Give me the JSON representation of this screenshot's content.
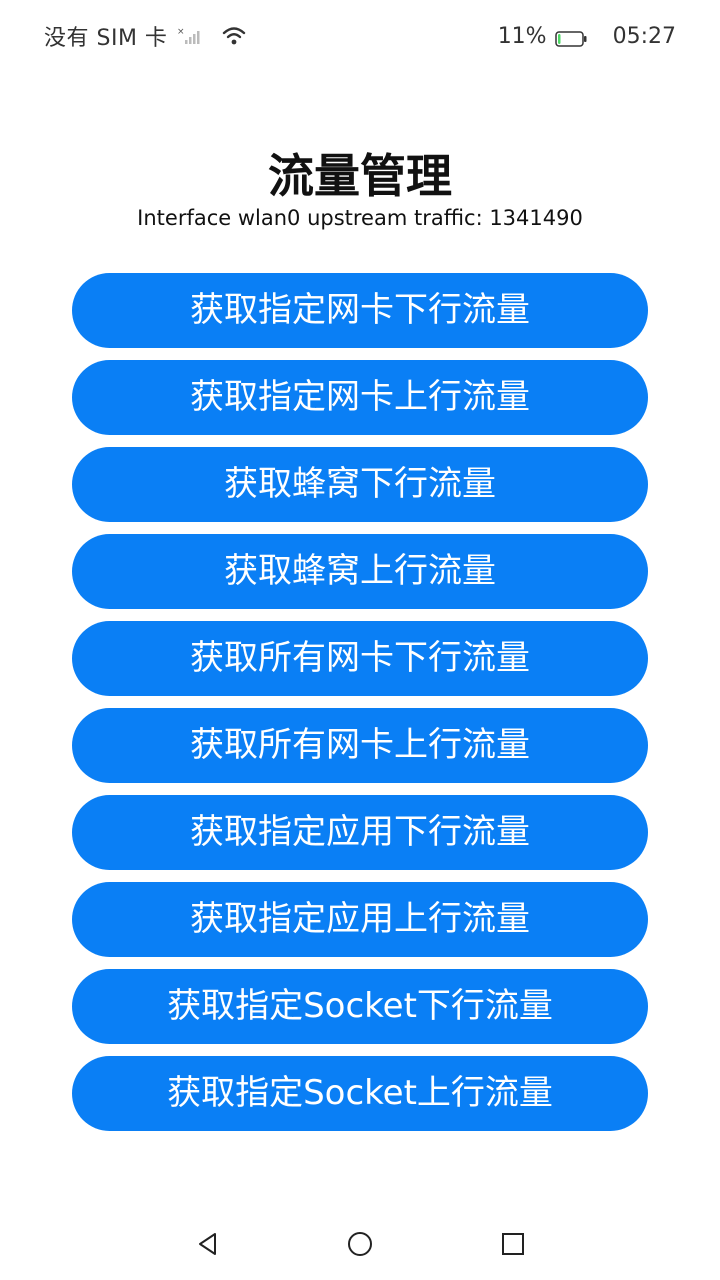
{
  "status_bar": {
    "sim_status": "没有 SIM 卡",
    "battery_percent": "11%",
    "time": "05:27",
    "battery_level": 0.11,
    "icons": [
      "signal-icon",
      "wifi-icon",
      "battery-icon"
    ]
  },
  "header": {
    "title": "流量管理",
    "traffic_info": "Interface wlan0 upstream traffic: 1341490"
  },
  "buttons": [
    {
      "label": "获取指定网卡下行流量"
    },
    {
      "label": "获取指定网卡上行流量"
    },
    {
      "label": "获取蜂窝下行流量"
    },
    {
      "label": "获取蜂窝上行流量"
    },
    {
      "label": "获取所有网卡下行流量"
    },
    {
      "label": "获取所有网卡上行流量"
    },
    {
      "label": "获取指定应用下行流量"
    },
    {
      "label": "获取指定应用上行流量"
    },
    {
      "label": "获取指定Socket下行流量"
    },
    {
      "label": "获取指定Socket上行流量"
    }
  ],
  "nav_bar": {
    "icons": [
      "back-icon",
      "home-icon",
      "recent-apps-icon"
    ]
  },
  "colors": {
    "button_background": "#0a7ff5",
    "button_text": "#ffffff",
    "battery_low": "#4cd964"
  }
}
